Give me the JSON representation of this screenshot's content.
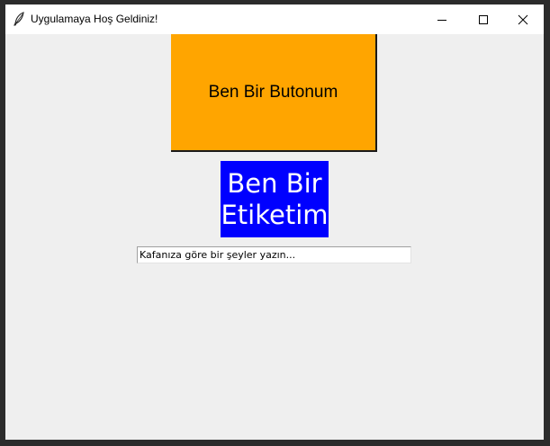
{
  "window": {
    "title": "Uygulamaya Hoş Geldiniz!",
    "icon": "feather-icon",
    "controls": [
      "minimize-icon",
      "maximize-icon",
      "close-icon"
    ]
  },
  "main": {
    "button_label": "Ben Bir Butonum",
    "button_color": "#ffa500",
    "label_text": "Ben Bir\nEtiketim",
    "label_bg_color": "#0000ff",
    "label_text_color": "#ffffff",
    "entry_value": "Kafanıza göre bir şeyler yazın..."
  }
}
